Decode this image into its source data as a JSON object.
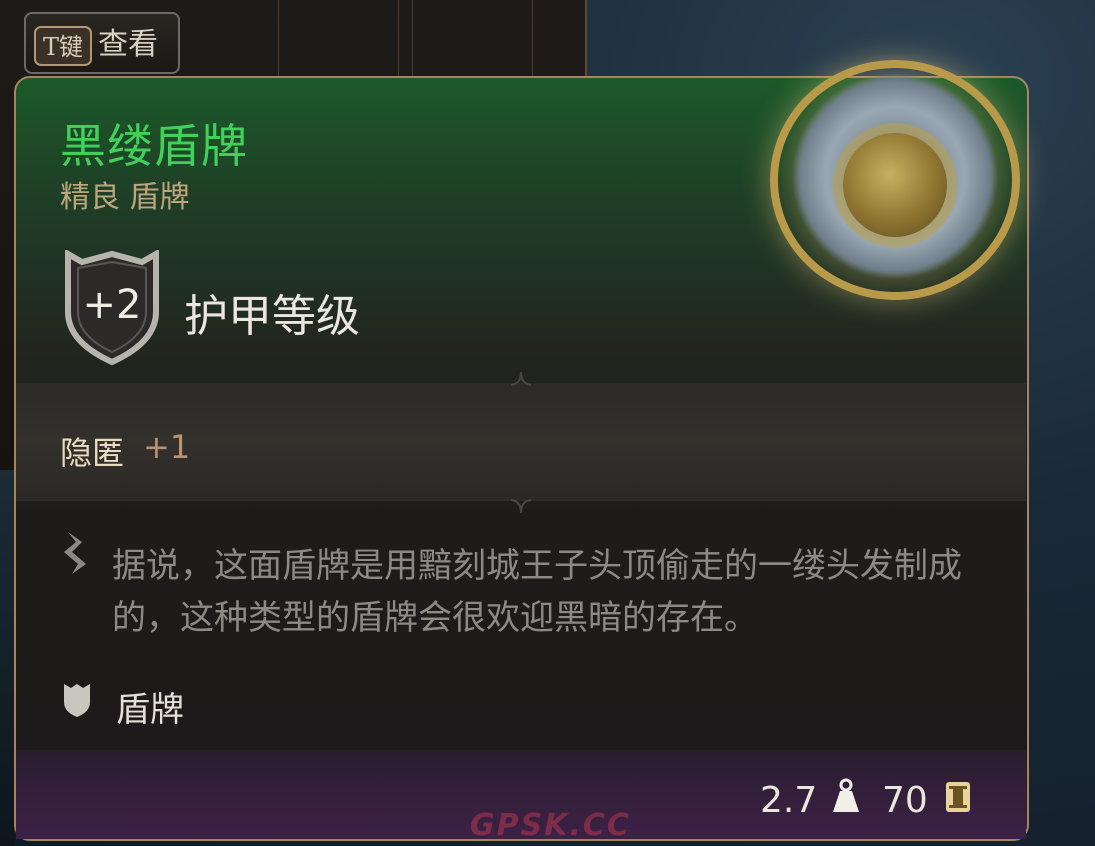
{
  "hint": {
    "key": "T键",
    "label": "查看"
  },
  "item": {
    "name": "黑缕盾牌",
    "subtitle": "精良 盾牌",
    "armor_class_value": "+2",
    "armor_class_label": "护甲等级",
    "stealth_label": "隐匿",
    "stealth_value": "+1",
    "lore": "据说，这面盾牌是用黯刻城王子头顶偷走的一缕头发制成的，这种类型的盾牌会很欢迎黑暗的存在。",
    "type_label": "盾牌",
    "weight": "2.7",
    "price": "70"
  },
  "watermark": "GPSK.CC",
  "colors": {
    "name": "#41d05a",
    "subtitle": "#bda57c",
    "border": "#a38660"
  },
  "icons": [
    "shield-badge-icon",
    "lore-scroll-icon",
    "shield-type-icon",
    "weight-icon",
    "gold-coin-icon"
  ]
}
